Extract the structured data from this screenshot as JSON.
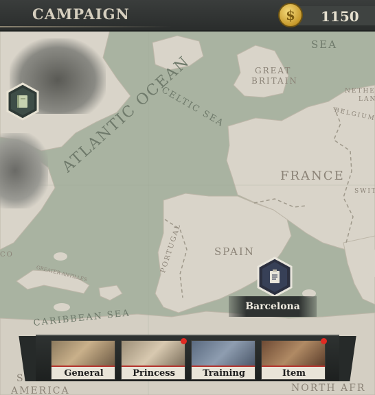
{
  "header": {
    "title": "CAMPAIGN",
    "gold_amount": "1150",
    "coin_icon": "dollar-coin-icon"
  },
  "map": {
    "sea_labels": [
      "ATLANTIC OCEAN",
      "CELTIC SEA",
      "SEA",
      "CARIBBEAN SEA"
    ],
    "country_labels": [
      "FRANCE",
      "SPAIN",
      "GREAT",
      "BRITAIN",
      "PORTUGAL",
      "BELGIUM",
      "NETHE",
      "LAND",
      "SWITZE",
      "GREATER ANTILLES",
      "SO",
      "AMERICA",
      "NORTH AFR",
      "CO"
    ]
  },
  "markers": {
    "left_marker_icon": "book-icon",
    "city_marker_icon": "document-icon",
    "city_name": "Barcelona"
  },
  "menu": {
    "buttons": [
      {
        "label": "General",
        "badge": false
      },
      {
        "label": "Princess",
        "badge": true
      },
      {
        "label": "Training",
        "badge": false
      },
      {
        "label": "Item",
        "badge": true
      }
    ]
  },
  "colors": {
    "sea": "#a9b3a1",
    "land": "#d9d4c9",
    "badge": "#e12a22",
    "label_accent": "#b4322c"
  }
}
